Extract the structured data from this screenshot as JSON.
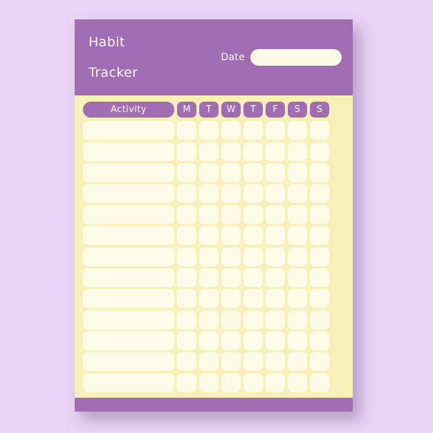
{
  "theme": {
    "page_background": "#ead3f5",
    "accent_purple": "#a06cb4",
    "paper_yellow": "#f7f1b9",
    "cell_cream": "#fdfbe8"
  },
  "header": {
    "title_line_1": "Habit",
    "title_line_2": "Tracker",
    "date_label": "Date",
    "date_value": "",
    "date_placeholder": ""
  },
  "table": {
    "activity_header": "Activity",
    "day_headers": [
      "M",
      "T",
      "W",
      "T",
      "F",
      "S",
      "S"
    ],
    "row_count": 13,
    "rows": [
      {
        "activity": "",
        "days": [
          "",
          "",
          "",
          "",
          "",
          "",
          ""
        ]
      },
      {
        "activity": "",
        "days": [
          "",
          "",
          "",
          "",
          "",
          "",
          ""
        ]
      },
      {
        "activity": "",
        "days": [
          "",
          "",
          "",
          "",
          "",
          "",
          ""
        ]
      },
      {
        "activity": "",
        "days": [
          "",
          "",
          "",
          "",
          "",
          "",
          ""
        ]
      },
      {
        "activity": "",
        "days": [
          "",
          "",
          "",
          "",
          "",
          "",
          ""
        ]
      },
      {
        "activity": "",
        "days": [
          "",
          "",
          "",
          "",
          "",
          "",
          ""
        ]
      },
      {
        "activity": "",
        "days": [
          "",
          "",
          "",
          "",
          "",
          "",
          ""
        ]
      },
      {
        "activity": "",
        "days": [
          "",
          "",
          "",
          "",
          "",
          "",
          ""
        ]
      },
      {
        "activity": "",
        "days": [
          "",
          "",
          "",
          "",
          "",
          "",
          ""
        ]
      },
      {
        "activity": "",
        "days": [
          "",
          "",
          "",
          "",
          "",
          "",
          ""
        ]
      },
      {
        "activity": "",
        "days": [
          "",
          "",
          "",
          "",
          "",
          "",
          ""
        ]
      },
      {
        "activity": "",
        "days": [
          "",
          "",
          "",
          "",
          "",
          "",
          ""
        ]
      },
      {
        "activity": "",
        "days": [
          "",
          "",
          "",
          "",
          "",
          "",
          ""
        ]
      }
    ],
    "activity_row_placeholder": ""
  },
  "footer": {
    "label": ""
  }
}
